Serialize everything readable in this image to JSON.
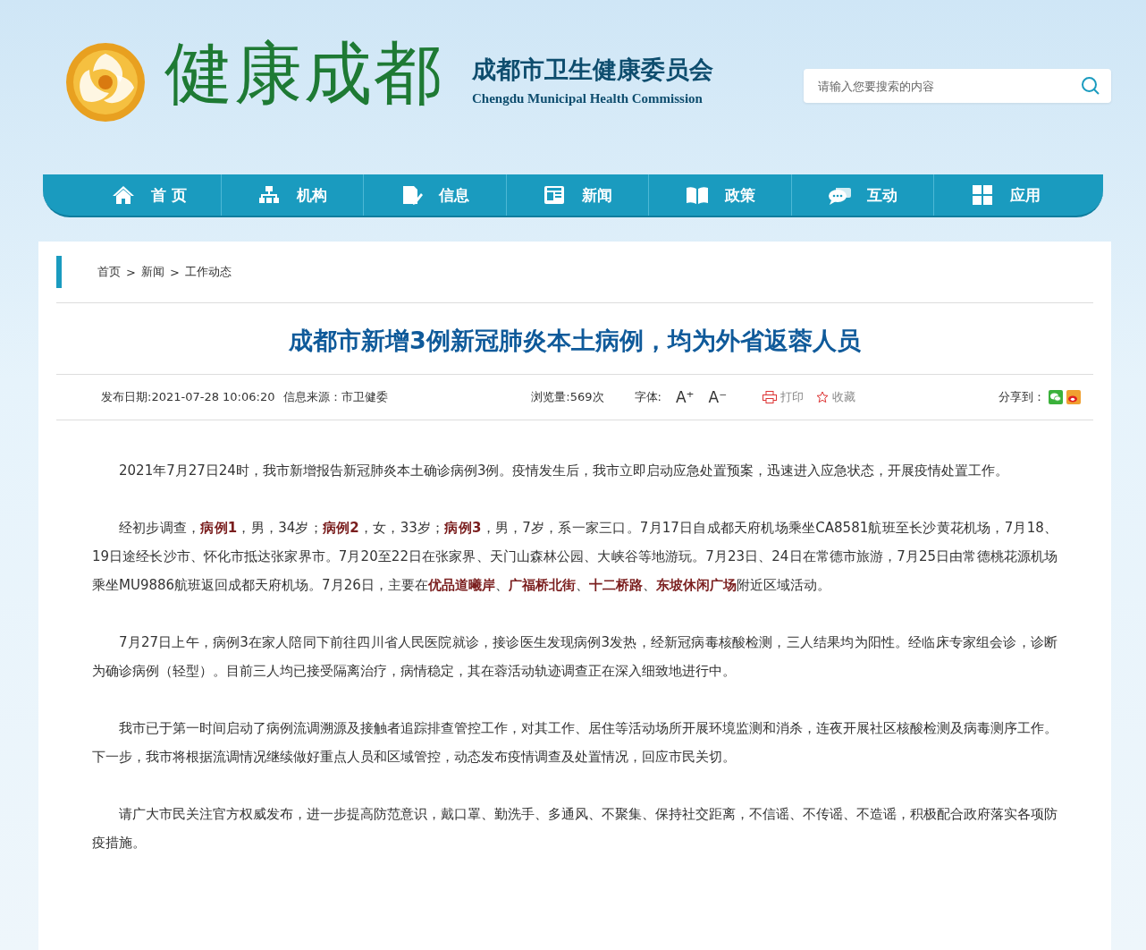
{
  "header": {
    "logo_text": "健康成都",
    "org_name": "成都市卫生健康委员会",
    "org_name_en": "Chengdu Municipal Health Commission",
    "search": {
      "placeholder": "请输入您要搜索的内容"
    }
  },
  "nav": [
    {
      "kind": "home",
      "label": "首 页"
    },
    {
      "kind": "org",
      "label": "机构"
    },
    {
      "kind": "info",
      "label": "信息"
    },
    {
      "kind": "news",
      "label": "新闻"
    },
    {
      "kind": "book",
      "label": "政策"
    },
    {
      "kind": "chat",
      "label": "互动"
    },
    {
      "kind": "apps",
      "label": "应用"
    }
  ],
  "breadcrumb": [
    "首页",
    "新闻",
    "工作动态"
  ],
  "breadcrumb_separator": ">",
  "article": {
    "title": "成都市新增3例新冠肺炎本土病例，均为外省返蓉人员",
    "meta": {
      "date": "发布日期:2021-07-28 10:06:20",
      "source": "信息来源：市卫健委",
      "views": "浏览量:569次",
      "font_label": "字体:",
      "font_up": "A⁺",
      "font_down": "A⁻",
      "print": "打印",
      "favorite": "收藏",
      "share": "分享到："
    },
    "paragraphs": [
      "2021年7月27日24时，我市新增报告新冠肺炎本土确诊病例3例。疫情发生后，我市立即启动应急处置预案，迅速进入应急状态，开展疫情处置工作。",
      "经初步调查，**病例1**，男，34岁；**病例2**，女，33岁；**病例3**，男，7岁，系一家三口。7月17日自成都天府机场乘坐CA8581航班至长沙黄花机场，7月18、19日途经长沙市、怀化市抵达张家界市。7月20至22日在张家界、天门山森林公园、大峡谷等地游玩。7月23日、24日在常德市旅游，7月25日由常德桃花源机场乘坐MU9886航班返回成都天府机场。7月26日，主要在**优品道曦岸**、**广福桥北街**、**十二桥路**、**东坡休闲广场**附近区域活动。",
      "7月27日上午，病例3在家人陪同下前往四川省人民医院就诊，接诊医生发现病例3发热，经新冠病毒核酸检测，三人结果均为阳性。经临床专家组会诊，诊断为确诊病例（轻型）。目前三人均已接受隔离治疗，病情稳定，其在蓉活动轨迹调查正在深入细致地进行中。",
      "我市已于第一时间启动了病例流调溯源及接触者追踪排查管控工作，对其工作、居住等活动场所开展环境监测和消杀，连夜开展社区核酸检测及病毒测序工作。下一步，我市将根据流调情况继续做好重点人员和区域管控，动态发布疫情调查及处置情况，回应市民关切。",
      "请广大市民关注官方权威发布，进一步提高防范意识，戴口罩、勤洗手、多通风、不聚集、保持社交距离，不信谣、不传谣、不造谣，积极配合政府落实各项防疫措施。"
    ]
  }
}
